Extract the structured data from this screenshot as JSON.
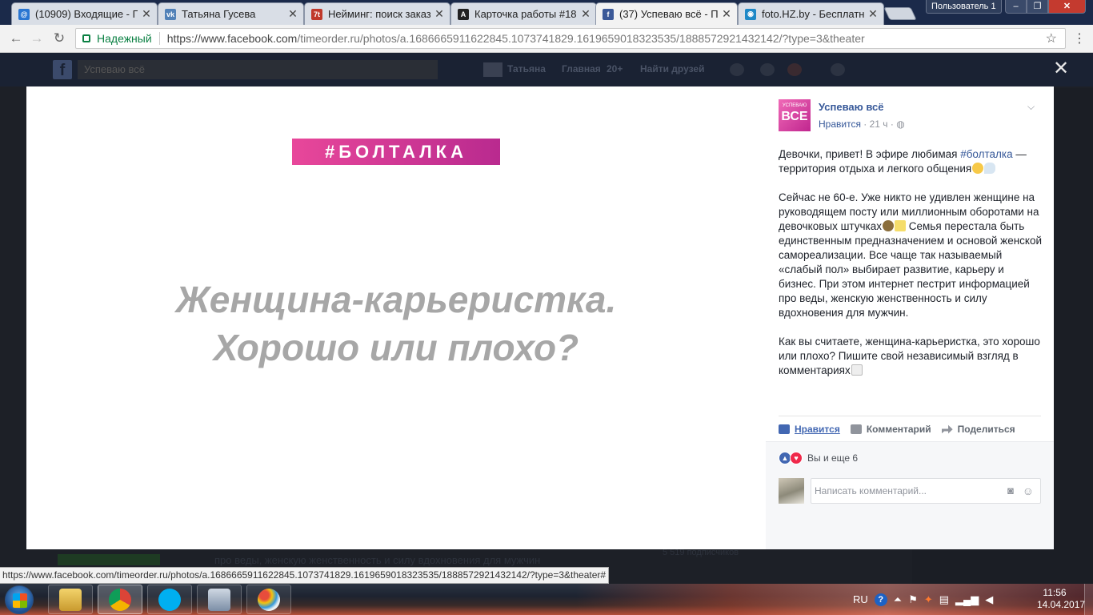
{
  "browser": {
    "tabs": [
      {
        "title": "(10909) Входящие - П",
        "favicon": "mail-icon",
        "color": "#2a76d2"
      },
      {
        "title": "Татьяна Гусева",
        "favicon": "vk-icon",
        "color": "#5181b8"
      },
      {
        "title": "Нейминг: поиск заказ",
        "favicon": "7t-icon",
        "color": "#c0392b"
      },
      {
        "title": "Карточка работы #18",
        "favicon": "a-icon",
        "color": "#222222"
      },
      {
        "title": "(37) Успеваю всё - Пу",
        "favicon": "facebook-icon",
        "color": "#3b5998"
      },
      {
        "title": "foto.HZ.by - Бесплатн",
        "favicon": "photo-icon",
        "color": "#1e88c7"
      }
    ],
    "close_glyph": "✕",
    "user_label": "Пользователь 1",
    "win_min": "‒",
    "win_max": "❐",
    "win_close": "✕",
    "security_label": "Надежный",
    "url_domain": "https://www.facebook.com",
    "url_path": "/timeorder.ru/photos/a.1686665911622845.1073741829.1619659018323535/1888572921432142/?type=3&theater",
    "back_glyph": "←",
    "forward_glyph": "→",
    "reload_glyph": "↻",
    "star_glyph": "☆",
    "menu_glyph": "⋮",
    "status_url": "https://www.facebook.com/timeorder.ru/photos/a.1686665911622845.1073741829.1619659018323535/1888572921432142/?type=3&theater#"
  },
  "facebook": {
    "logo": "f",
    "search_value": "Успеваю всё",
    "nav_user": "Татьяна",
    "nav_home": "Главная",
    "nav_count": "20+",
    "nav_friends": "Найти друзей",
    "close_glyph": "✕",
    "bg_text": "про веды, женскую женственность и силу вдохновения для мужчин",
    "bg_subscribers": "5 519 подписчиков"
  },
  "photo": {
    "tag": "#БОЛТАЛКА",
    "headline_line1": "Женщина-карьеристка.",
    "headline_line2": "Хорошо или плохо?"
  },
  "post": {
    "avatar_small": "УСПЕВАЮ",
    "avatar_text": "ВСЕ",
    "page_name": "Успеваю всё",
    "like_page": "Нравится",
    "time": " · 21 ч · ",
    "globe": "◍",
    "chevron": "⌵",
    "p1_a": "Девочки, привет! В эфире любимая ",
    "p1_hashtag": "#болталка",
    "p1_b": " — территория отдыха и легкого общения",
    "p2_a": "Сейчас не 60-е. Уже никто не удивлен женщине на руководящем посту или миллионным оборотами на девочковых штучках",
    "p2_b": " Семья перестала быть единственным предназначением и основой женской самореализации. Все чаще так называемый «слабый пол» выбирает развитие, карьеру и бизнес. При этом интернет пестрит информацией про веды, женскую женственность и силу вдохновения для мужчин.",
    "p3": "Как вы считаете, женщина-карьеристка, это хорошо или плохо? Пишите свой независимый взгляд в комментариях",
    "action_like": "Нравится",
    "action_comment": "Комментарий",
    "action_share": "Поделиться",
    "reactions_text": "Вы и еще 6",
    "comment_placeholder": "Написать комментарий...",
    "camera_glyph": "◙",
    "smile_glyph": "☺"
  },
  "taskbar": {
    "apps": [
      "explorer-icon",
      "chrome-icon",
      "skype-icon",
      "calculator-icon",
      "paint-icon"
    ],
    "lang": "RU",
    "help_glyph": "?",
    "time": "11:56",
    "date": "14.04.2017"
  },
  "colors": {
    "fb_blue": "#365899",
    "fb_link": "#4267b2",
    "tag_pink": "#e8479a",
    "headline_gray": "#a7a7a7",
    "secure_green": "#0b8043"
  }
}
